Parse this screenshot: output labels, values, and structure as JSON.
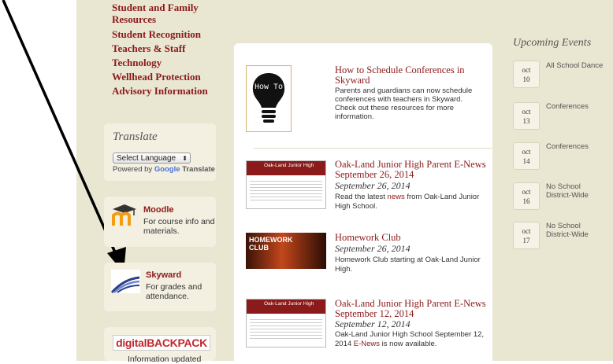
{
  "nav": {
    "items": [
      "Student and Family",
      "Resources",
      "Student Recognition",
      "Teachers & Staff",
      "Technology",
      "Wellhead Protection",
      "Advisory Information"
    ]
  },
  "translate": {
    "title": "Translate",
    "select_label": "Select Language",
    "powered_by": "Powered by",
    "google": "Google",
    "translate_word": "Translate"
  },
  "sidebar": {
    "moodle": {
      "title": "Moodle",
      "desc1": "For course info and",
      "desc2": "materials."
    },
    "skyward": {
      "title": "Skyward",
      "desc1": "For grades and",
      "desc2": "attendance."
    },
    "backpack": {
      "logo": "digitalBACKPACK",
      "desc": "Information updated"
    }
  },
  "articles": [
    {
      "thumb_text": "How To",
      "title": "How to Schedule Conferences in Skyward",
      "date": "",
      "text1": "Parents and guardians can now schedule",
      "text2": "conferences with teachers in Skyward.",
      "text3": " Check out these resources for more",
      "text4": "information."
    },
    {
      "thumb_text": "Oak-Land Junior High",
      "title": "Oak-Land Junior High Parent E-News September 26, 2014",
      "date": "September 26, 2014",
      "pre": "Read the latest ",
      "link": "news",
      "post": " from Oak-Land Junior",
      "text2": "High School."
    },
    {
      "thumb_text": "HOMEWORK CLUB",
      "title": "Homework Club",
      "date": "September 26, 2014",
      "text1": "Homework Club starting at Oak-Land Junior",
      "text2": "High."
    },
    {
      "thumb_text": "Oak-Land Junior High",
      "title": "Oak-Land Junior High Parent E-News September 12, 2014",
      "date": "September 12, 2014",
      "text1": "Oak-Land Junior High School September 12,",
      "pre2": "2014 ",
      "link": "E-News",
      "post2": " is now available."
    }
  ],
  "events": {
    "heading": "Upcoming Events",
    "items": [
      {
        "month": "oct",
        "day": "10",
        "title1": "All School Dance",
        "title2": ""
      },
      {
        "month": "oct",
        "day": "13",
        "title1": "Conferences",
        "title2": ""
      },
      {
        "month": "oct",
        "day": "14",
        "title1": "Conferences",
        "title2": ""
      },
      {
        "month": "oct",
        "day": "16",
        "title1": "No School",
        "title2": "District-Wide"
      },
      {
        "month": "oct",
        "day": "17",
        "title1": "No School",
        "title2": "District-Wide"
      }
    ]
  },
  "colors": {
    "accent": "#8b1a1a",
    "page_bg": "#e9e6d2",
    "panel_bg": "#f3efe1",
    "annotation_arrow": "#000000"
  }
}
